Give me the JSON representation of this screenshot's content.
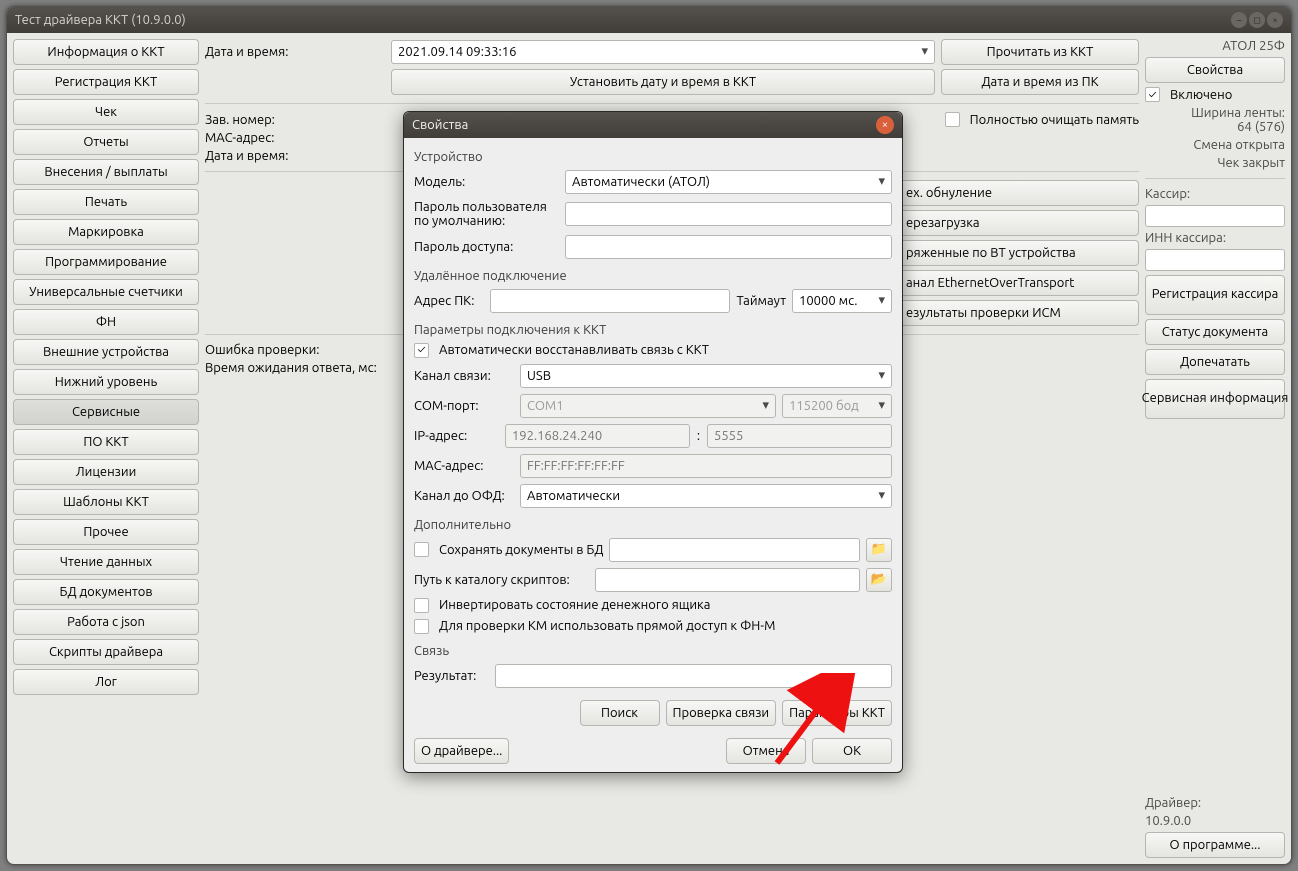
{
  "window_title": "Тест драйвера ККТ (10.9.0.0)",
  "left_nav": {
    "info": "Информация о ККТ",
    "reg": "Регистрация ККТ",
    "chk": "Чек",
    "rep": "Отчеты",
    "pay": "Внесения / выплаты",
    "prn": "Печать",
    "mark": "Маркировка",
    "prog": "Программирование",
    "cnt": "Универсальные счетчики",
    "fn": "ФН",
    "ext": "Внешние устройства",
    "low": "Нижний уровень",
    "srv": "Сервисные",
    "po": "ПО ККТ",
    "lic": "Лицензии",
    "tpl": "Шаблоны ККТ",
    "other": "Прочее",
    "read": "Чтение данных",
    "bd": "БД документов",
    "json": "Работа с json",
    "scr": "Скрипты драйвера",
    "log": "Лог"
  },
  "mid": {
    "date_time_label": "Дата и время:",
    "date_time_value": "2021.09.14 09:33:16",
    "btn_read": "Прочитать из ККТ",
    "btn_set_dt": "Установить дату и время в ККТ",
    "btn_dt_pc": "Дата и время из ПК",
    "zav_label": "Зав. номер:",
    "mac_label": "MAC-адрес:",
    "dt_label": "Дата и время:",
    "clear_mem": "Полностью очищать память",
    "btn_zero": "ех. обнуление",
    "btn_reboot": "ерезагрузка",
    "btn_bt": "ряженные по BT устройства",
    "btn_eth": "анал EthernetOverTransport",
    "btn_ism": "езультаты проверки ИСМ",
    "err_label": "Ошибка проверки:",
    "timeout_label": "Время ожидания ответа, мс:"
  },
  "right": {
    "model": "АТОЛ 25Ф",
    "props": "Свойства",
    "enabled": "Включено",
    "width": "Ширина ленты:\n64 (576)",
    "shift": "Смена открыта",
    "cheque": "Чек закрыт",
    "cashier": "Кассир:",
    "inn": "ИНН кассира:",
    "regc": "Регистрация кассира",
    "docst": "Статус документа",
    "print_more": "Допечатать",
    "srvinfo": "Сервисная информация",
    "driver": "Драйвер:",
    "driver_v": "10.9.0.0",
    "about": "О программе..."
  },
  "dialog": {
    "title": "Свойства",
    "grp_device": "Устройство",
    "model_lbl": "Модель:",
    "model_val": "Автоматически (АТОЛ)",
    "pwd_user_lbl": "Пароль пользователя по умолчанию:",
    "pwd_access_lbl": "Пароль доступа:",
    "grp_remote": "Удалённое подключение",
    "pc_addr_lbl": "Адрес ПК:",
    "timeout_lbl": "Таймаут",
    "timeout_val": "10000 мс.",
    "grp_conn": "Параметры подключения к ККТ",
    "auto_restore": "Автоматически восстанавливать связь с ККТ",
    "chan_lbl": "Канал связи:",
    "chan_val": "USB",
    "com_lbl": "COM-порт:",
    "com_val": "COM1",
    "baud_val": "115200 бод",
    "ip_lbl": "IP-адрес:",
    "ip_val": "192.168.24.240",
    "port_val": "5555",
    "mac_lbl": "MAC-адрес:",
    "mac_val": "FF:FF:FF:FF:FF:FF",
    "ofd_lbl": "Канал до ОФД:",
    "ofd_val": "Автоматически",
    "grp_extra": "Дополнительно",
    "save_db": "Сохранять документы в БД",
    "scripts_lbl": "Путь к каталогу скриптов:",
    "invert": "Инвертировать состояние денежного ящика",
    "direct": "Для проверки КМ использовать прямой доступ к ФН-М",
    "grp_link": "Связь",
    "result_lbl": "Результат:",
    "btn_search": "Поиск",
    "btn_check": "Проверка связи",
    "btn_params": "Параметры ККТ",
    "btn_about": "О драйвере...",
    "btn_cancel": "Отмена",
    "btn_ok": "ОК"
  }
}
